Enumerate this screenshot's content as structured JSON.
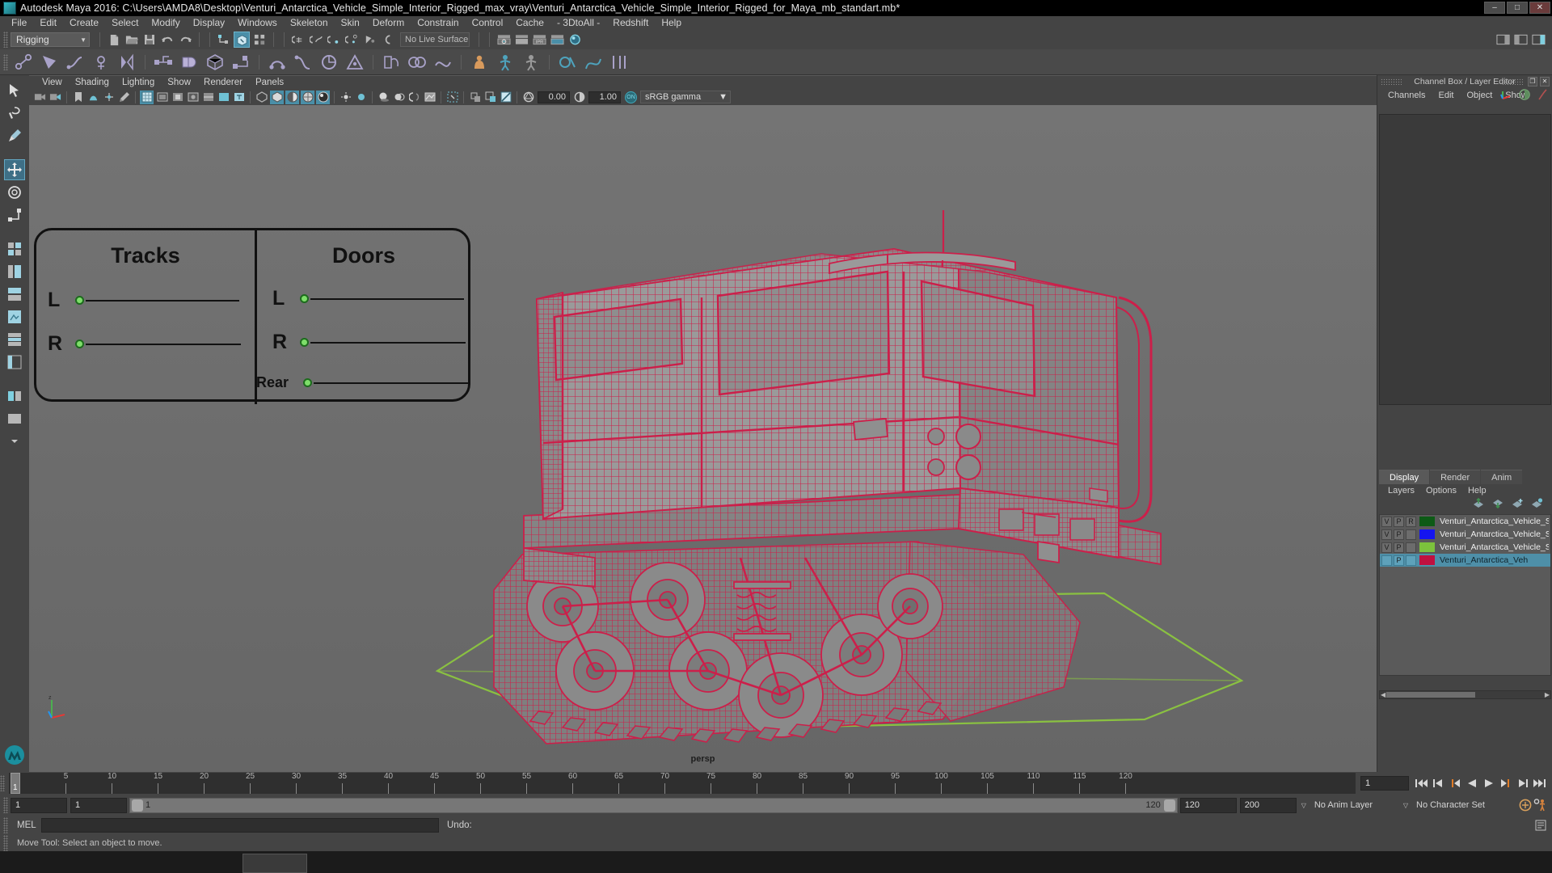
{
  "window": {
    "title": "Autodesk Maya 2016: C:\\Users\\AMDA8\\Desktop\\Venturi_Antarctica_Vehicle_Simple_Interior_Rigged_max_vray\\Venturi_Antarctica_Vehicle_Simple_Interior_Rigged_for_Maya_mb_standart.mb*",
    "minimize": "–",
    "maximize": "□",
    "close": "✕"
  },
  "menubar": {
    "items": [
      "File",
      "Edit",
      "Create",
      "Select",
      "Modify",
      "Display",
      "Windows",
      "Skeleton",
      "Skin",
      "Deform",
      "Constrain",
      "Control",
      "Cache",
      "- 3DtoAll -",
      "Redshift",
      "Help"
    ]
  },
  "toolbar": {
    "menu_set": "Rigging",
    "menu_set_caret": "▼",
    "live_surface": "No Live Surface"
  },
  "viewport_panel": {
    "menus": [
      "View",
      "Shading",
      "Lighting",
      "Show",
      "Renderer",
      "Panels"
    ],
    "exposure_value": "0.00",
    "gamma_value": "1.00",
    "color_profile": "sRGB gamma",
    "color_profile_caret": "▼",
    "cm_toggle": "ON",
    "camera_label": "persp"
  },
  "annotation": {
    "title_left": "Tracks",
    "title_right": "Doors",
    "left_rows": [
      "L",
      "R"
    ],
    "right_rows": [
      "L",
      "R",
      "Rear"
    ],
    "handle_fill": "#7ede6a",
    "handle_stroke": "#1d6b1d"
  },
  "channel_box": {
    "title": "Channel Box / Layer Editor",
    "undock_glyph": "❐",
    "close_glyph": "✕",
    "menus": [
      "Channels",
      "Edit",
      "Object",
      "Show"
    ]
  },
  "layer_editor": {
    "tabs": [
      "Display",
      "Render",
      "Anim"
    ],
    "active_tab": "Display",
    "menus": [
      "Layers",
      "Options",
      "Help"
    ],
    "layers": [
      {
        "v": "V",
        "p": "P",
        "r": "R",
        "color": "#0d5a16",
        "name": "Venturi_Antarctica_Vehicle_Si",
        "selected": false
      },
      {
        "v": "V",
        "p": "P",
        "r": "",
        "color": "#1414f0",
        "name": "Venturi_Antarctica_Vehicle_Si",
        "selected": false
      },
      {
        "v": "V",
        "p": "P",
        "r": "",
        "color": "#7cc23c",
        "name": "Venturi_Antarctica_Vehicle_Si",
        "selected": false
      },
      {
        "v": "",
        "p": "P",
        "r": "",
        "color": "#c01040",
        "name": "Venturi_Antarctica_Veh",
        "selected": true
      }
    ]
  },
  "timeline": {
    "ticks": [
      5,
      10,
      15,
      20,
      25,
      30,
      35,
      40,
      45,
      50,
      55,
      60,
      65,
      70,
      75,
      80,
      85,
      90,
      95,
      100,
      105,
      110,
      115,
      120
    ],
    "current_frame_marker": "1",
    "current_frame_field": "1",
    "playback_buttons": [
      "⏮⏮",
      "⏮",
      "◀|",
      "◀",
      "▶",
      "|▶",
      "⏭",
      "⏭⏭"
    ]
  },
  "range_slider": {
    "start_field": "1",
    "playback_start_field": "1",
    "range_start_label": "1",
    "range_end_label": "120",
    "playback_end_field": "120",
    "end_field": "200",
    "anim_layer": "No Anim Layer",
    "character_set": "No Character Set",
    "caret": "▽"
  },
  "command_line": {
    "language_label": "MEL",
    "input_value": "",
    "undo_label": "Undo:",
    "undo_value": ""
  },
  "status": {
    "help_text": "Move Tool: Select an object to move."
  },
  "colors": {
    "accent_blue": "#4a8fa8",
    "wire_red": "#cc1f4a",
    "ground_green": "#8cc63f",
    "panel_bg": "#444444",
    "viewport_bg": "#6e6e6e"
  }
}
